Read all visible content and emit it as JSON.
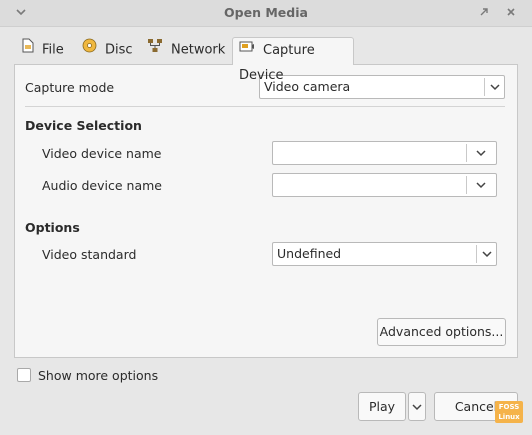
{
  "window": {
    "title": "Open Media",
    "collapse_icon": "chevron-down-icon",
    "restore_icon": "restore-icon",
    "close_icon": "close-icon"
  },
  "tabs": [
    {
      "label": "File",
      "icon": "file-icon"
    },
    {
      "label": "Disc",
      "icon": "disc-icon"
    },
    {
      "label": "Network",
      "icon": "network-icon"
    },
    {
      "label": "Capture Device",
      "icon": "capture-device-icon",
      "active": true
    }
  ],
  "capture": {
    "mode_label": "Capture mode",
    "mode_value": "Video camera"
  },
  "device_selection": {
    "heading": "Device Selection",
    "video_label": "Video device name",
    "video_value": "",
    "audio_label": "Audio device name",
    "audio_value": ""
  },
  "options": {
    "heading": "Options",
    "standard_label": "Video standard",
    "standard_value": "Undefined",
    "advanced_button": "Advanced options..."
  },
  "footer": {
    "show_more": "Show more options",
    "show_more_checked": false,
    "play": "Play",
    "cancel": "Cancel"
  },
  "watermark": {
    "line1": "FOSS",
    "line2": "Linux"
  },
  "colors": {
    "accent": "#f5b34a",
    "panel": "#f6f6f6",
    "window": "#e7e7e7"
  }
}
